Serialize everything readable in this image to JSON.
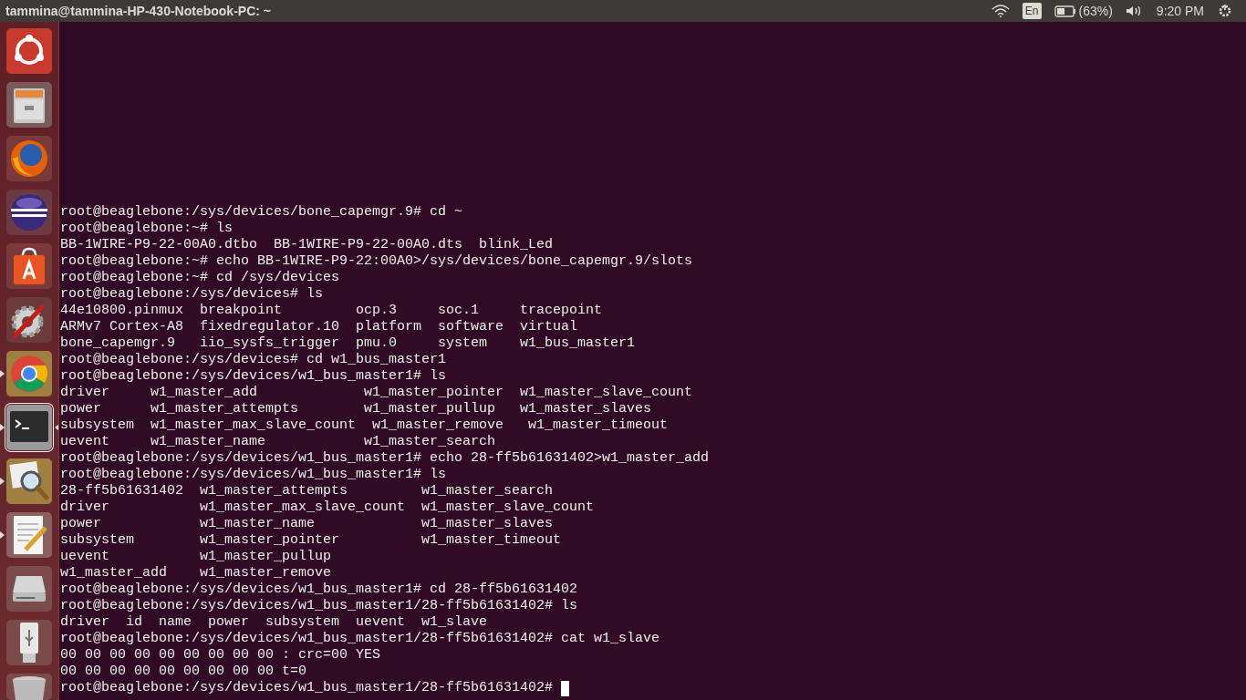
{
  "top_bar": {
    "title": "tammina@tammina-HP-430-Notebook-PC: ~",
    "keyboard": "En",
    "battery": "(63%)",
    "clock": "9:20 PM"
  },
  "launcher": [
    {
      "kind": "dash",
      "running": false,
      "focused": false
    },
    {
      "kind": "files",
      "running": false,
      "focused": false
    },
    {
      "kind": "firefox",
      "running": false,
      "focused": false
    },
    {
      "kind": "eclipse",
      "running": false,
      "focused": false
    },
    {
      "kind": "store",
      "running": false,
      "focused": false
    },
    {
      "kind": "settings",
      "running": false,
      "focused": false
    },
    {
      "kind": "chrome",
      "running": true,
      "focused": false
    },
    {
      "kind": "terminal",
      "running": true,
      "focused": true
    },
    {
      "kind": "viewer",
      "running": true,
      "focused": false
    },
    {
      "kind": "editor",
      "running": true,
      "focused": false
    },
    {
      "kind": "disk",
      "running": false,
      "focused": false
    },
    {
      "kind": "usb",
      "running": false,
      "focused": false
    },
    {
      "kind": "trash",
      "running": false,
      "focused": false
    }
  ],
  "terminal": {
    "lines": [
      "root@beaglebone:/sys/devices/bone_capemgr.9# cd ~",
      "root@beaglebone:~# ls",
      "BB-1WIRE-P9-22-00A0.dtbo  BB-1WIRE-P9-22-00A0.dts  blink_Led",
      "root@beaglebone:~# echo BB-1WIRE-P9-22:00A0>/sys/devices/bone_capemgr.9/slots",
      "root@beaglebone:~# cd /sys/devices",
      "root@beaglebone:/sys/devices# ls",
      "44e10800.pinmux  breakpoint         ocp.3     soc.1     tracepoint",
      "ARMv7 Cortex-A8  fixedregulator.10  platform  software  virtual",
      "bone_capemgr.9   iio_sysfs_trigger  pmu.0     system    w1_bus_master1",
      "root@beaglebone:/sys/devices# cd w1_bus_master1",
      "root@beaglebone:/sys/devices/w1_bus_master1# ls",
      "driver     w1_master_add             w1_master_pointer  w1_master_slave_count",
      "power      w1_master_attempts        w1_master_pullup   w1_master_slaves",
      "subsystem  w1_master_max_slave_count  w1_master_remove   w1_master_timeout",
      "uevent     w1_master_name            w1_master_search",
      "root@beaglebone:/sys/devices/w1_bus_master1# echo 28-ff5b61631402>w1_master_add",
      "root@beaglebone:/sys/devices/w1_bus_master1# ls",
      "28-ff5b61631402  w1_master_attempts         w1_master_search",
      "driver           w1_master_max_slave_count  w1_master_slave_count",
      "power            w1_master_name             w1_master_slaves",
      "subsystem        w1_master_pointer          w1_master_timeout",
      "uevent           w1_master_pullup",
      "w1_master_add    w1_master_remove",
      "root@beaglebone:/sys/devices/w1_bus_master1# cd 28-ff5b61631402",
      "root@beaglebone:/sys/devices/w1_bus_master1/28-ff5b61631402# ls",
      "driver  id  name  power  subsystem  uevent  w1_slave",
      "root@beaglebone:/sys/devices/w1_bus_master1/28-ff5b61631402# cat w1_slave",
      "00 00 00 00 00 00 00 00 00 : crc=00 YES",
      "00 00 00 00 00 00 00 00 00 t=0"
    ],
    "prompt": "root@beaglebone:/sys/devices/w1_bus_master1/28-ff5b61631402# "
  }
}
